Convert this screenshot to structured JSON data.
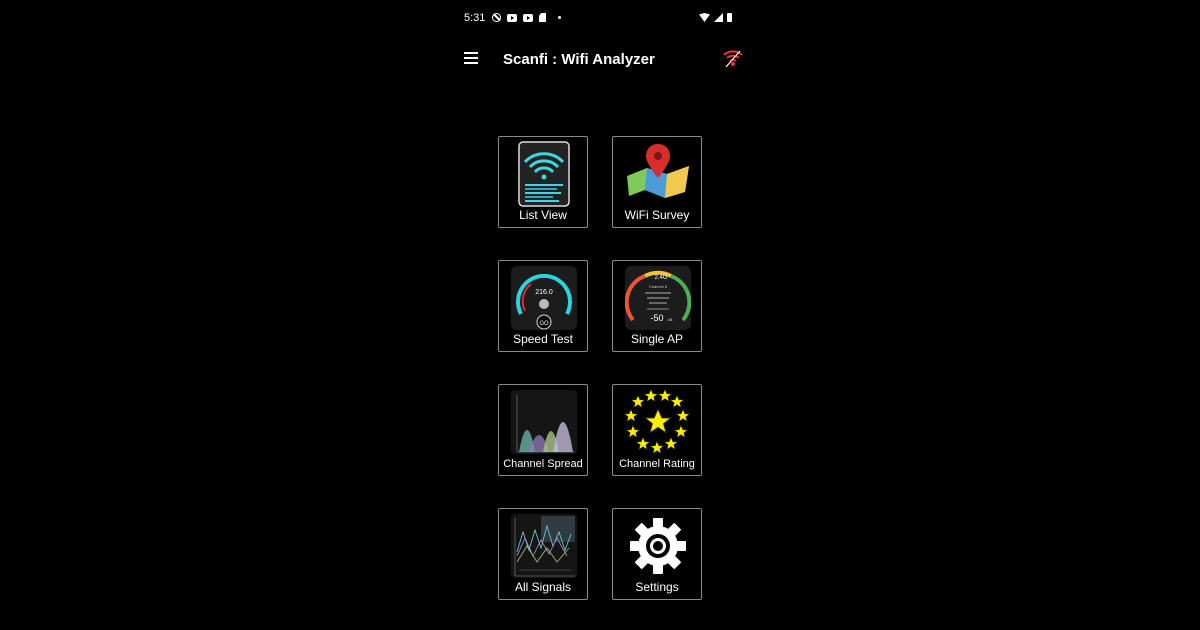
{
  "status_bar": {
    "time": "5:31"
  },
  "app_bar": {
    "title": "Scanfi : Wifi Analyzer"
  },
  "tiles": [
    {
      "label": "List View"
    },
    {
      "label": "WiFi Survey"
    },
    {
      "label": "Speed Test"
    },
    {
      "label": "Single AP"
    },
    {
      "label": "Channel Spread"
    },
    {
      "label": "Channel Rating"
    },
    {
      "label": "All Signals"
    },
    {
      "label": "Settings"
    }
  ],
  "speed_test_icon": {
    "value": "216.0",
    "button": "GO"
  },
  "single_ap_icon": {
    "band": "2.4G",
    "channel": "Channel 6",
    "signal": "-50",
    "unit": "dB"
  },
  "colors": {
    "background": "#000000",
    "tile_border": "#8a8a8a",
    "text": "#ffffff",
    "star": "#ffee00",
    "accent_cyan": "#29d3e0"
  }
}
